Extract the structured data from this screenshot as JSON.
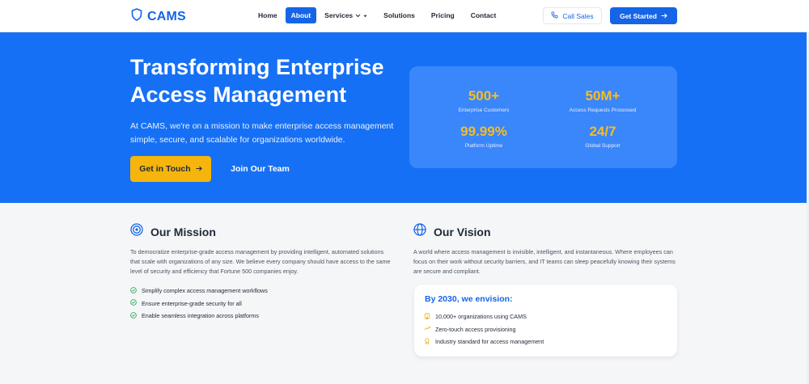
{
  "brand": {
    "name": "CAMS",
    "logo_icon": "shield-icon"
  },
  "nav": {
    "items": [
      {
        "label": "Home"
      },
      {
        "label": "About"
      },
      {
        "label": "Services"
      },
      {
        "label": "Solutions"
      },
      {
        "label": "Pricing"
      },
      {
        "label": "Contact"
      }
    ],
    "active": "About"
  },
  "header": {
    "call_label": "Call Sales",
    "start_label": "Get Started"
  },
  "hero": {
    "title": "Transforming Enterprise Access Management",
    "subtitle": "At CAMS, we're on a mission to make enterprise access management simple, secure, and scalable for organizations worldwide.",
    "primary_cta": "Get in Touch",
    "secondary_cta": "Join Our Team",
    "stats": [
      {
        "value": "500+",
        "label": "Enterprise Customers"
      },
      {
        "value": "50M+",
        "label": "Access Requests Processed"
      },
      {
        "value": "99.99%",
        "label": "Platform Uptime"
      },
      {
        "value": "24/7",
        "label": "Global Support"
      }
    ]
  },
  "mission": {
    "title": "Our Mission",
    "text": "To democratize enterprise-grade access management by providing intelligent, automated solutions that scale with organizations of any size. We believe every company should have access to the same level of security and efficiency that Fortune 500 companies enjoy.",
    "points": [
      "Simplify complex access management workflows",
      "Ensure enterprise-grade security for all",
      "Enable seamless integration across platforms"
    ]
  },
  "vision": {
    "title": "Our Vision",
    "text": "A world where access management is invisible, intelligent, and instantaneous. Where employees can focus on their work without security barriers, and IT teams can sleep peacefully knowing their systems are secure and compliant.",
    "card_title": "By 2030, we envision:",
    "points": [
      {
        "icon": "building-icon",
        "text": "10,000+ organizations using CAMS"
      },
      {
        "icon": "trending-up-icon",
        "text": "Zero-touch access provisioning"
      },
      {
        "icon": "award-icon",
        "text": "Industry standard for access management"
      }
    ]
  },
  "colors": {
    "primary": "#1565e6",
    "hero_bg": "#1670f5",
    "accent": "#f5b50c",
    "stat_value": "#f8bd20"
  }
}
